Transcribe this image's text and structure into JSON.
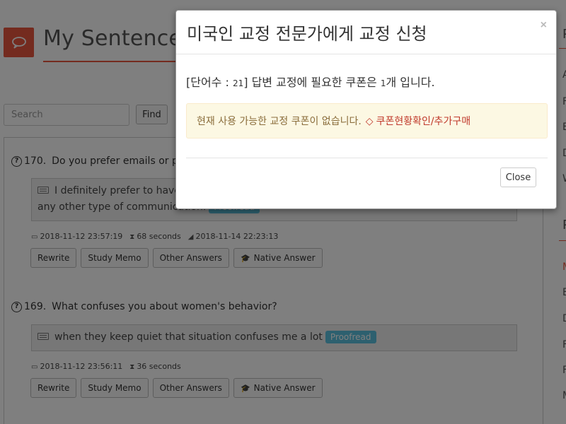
{
  "header": {
    "title": "My Sentences",
    "logo_icon": "speech-bubble-icon",
    "accent": "#e8563f"
  },
  "search": {
    "placeholder": "Search",
    "button_label": "Find"
  },
  "questions": [
    {
      "number": "170.",
      "question": "Do you prefer emails or pho",
      "answer": "I definitely prefer to have",
      "answer_line2": "any other type of communication.",
      "badge": "Proofread",
      "created": "2018-11-12 23:57:19",
      "duration": "68 seconds",
      "edited": "2018-11-14 22:23:13",
      "buttons": [
        "Rewrite",
        "Study Memo",
        "Other Answers",
        "Native Answer"
      ]
    },
    {
      "number": "169.",
      "question": "What confuses you about women's behavior?",
      "answer": "when they keep quiet that situation confuses me a lot",
      "badge": "Proofread",
      "created": "2018-11-12 23:56:11",
      "duration": "36 seconds",
      "buttons": [
        "Rewrite",
        "Study Memo",
        "Other Answers",
        "Native Answer"
      ]
    }
  ],
  "right_sidebar": {
    "items": [
      "P",
      "A",
      "F",
      "E",
      "D",
      "W",
      "P",
      "M",
      "E",
      "D",
      "F",
      "F",
      "M"
    ]
  },
  "modal": {
    "title": "미국인 교정 전문가에게 교정 신청",
    "close_x": "×",
    "word_count_label": "[단어수 : ",
    "word_count": "21",
    "word_count_suffix": "] 답변 교정에 필요한 쿠폰은 ",
    "coupon_count": "1",
    "coupon_suffix": "개 입니다.",
    "alert_text": "현재 사용 가능한 교정 쿠폰이 없습니다.",
    "alert_link": "쿠폰현황확인/추가구매",
    "close_button": "Close"
  }
}
